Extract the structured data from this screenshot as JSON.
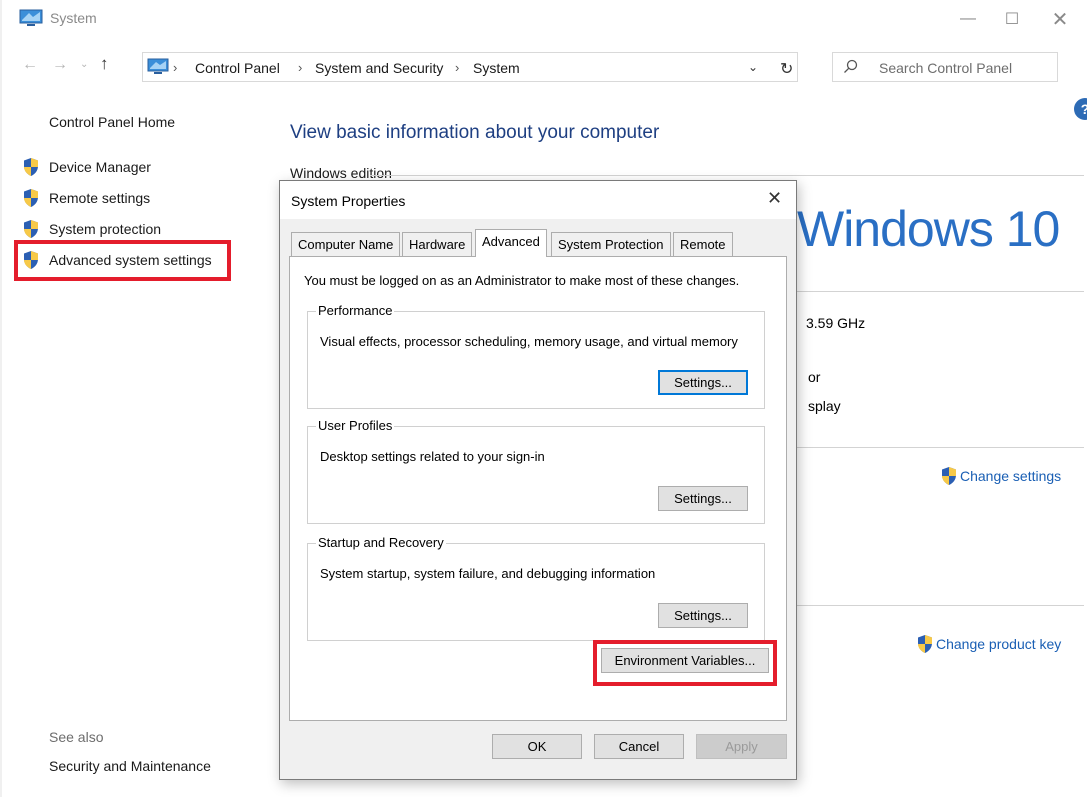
{
  "window": {
    "title": "System",
    "min_glyph": "—",
    "max_glyph": "☐",
    "close_glyph": "✕"
  },
  "nav": {
    "back": "←",
    "forward": "→",
    "recent": "⌄",
    "up": "↑",
    "breadcrumbs": [
      "Control Panel",
      "System and Security",
      "System"
    ],
    "separator": "›",
    "dropdown": "⌄",
    "refresh": "↻",
    "search_placeholder": "Search Control Panel"
  },
  "help": "?",
  "sidebar": {
    "home": "Control Panel Home",
    "items": [
      "Device Manager",
      "Remote settings",
      "System protection",
      "Advanced system settings"
    ],
    "see_also": "See also",
    "see_also_items": [
      "Security and Maintenance"
    ]
  },
  "main": {
    "title": "View basic information about your computer",
    "section_windows_edition": "Windows edition",
    "windows_logo_text": "Windows 10",
    "cpu_speed_fragment": "3.59 GHz",
    "fragment_or": "or",
    "fragment_splay": "splay",
    "change_settings": "Change settings",
    "change_product_key": "Change product key"
  },
  "dialog": {
    "title": "System Properties",
    "close_glyph": "✕",
    "tabs": [
      "Computer Name",
      "Hardware",
      "Advanced",
      "System Protection",
      "Remote"
    ],
    "active_tab": "Advanced",
    "admin_note": "You must be logged on as an Administrator to make most of these changes.",
    "groups": [
      {
        "label": "Performance",
        "desc": "Visual effects, processor scheduling, memory usage, and virtual memory",
        "button": "Settings..."
      },
      {
        "label": "User Profiles",
        "desc": "Desktop settings related to your sign-in",
        "button": "Settings..."
      },
      {
        "label": "Startup and Recovery",
        "desc": "System startup, system failure, and debugging information",
        "button": "Settings..."
      }
    ],
    "env_button": "Environment Variables...",
    "ok": "OK",
    "cancel": "Cancel",
    "apply": "Apply"
  },
  "colors": {
    "highlight": "#e41d2c",
    "link": "#1a5fb4",
    "title_blue": "#1e3f82",
    "focus": "#0078d7"
  }
}
